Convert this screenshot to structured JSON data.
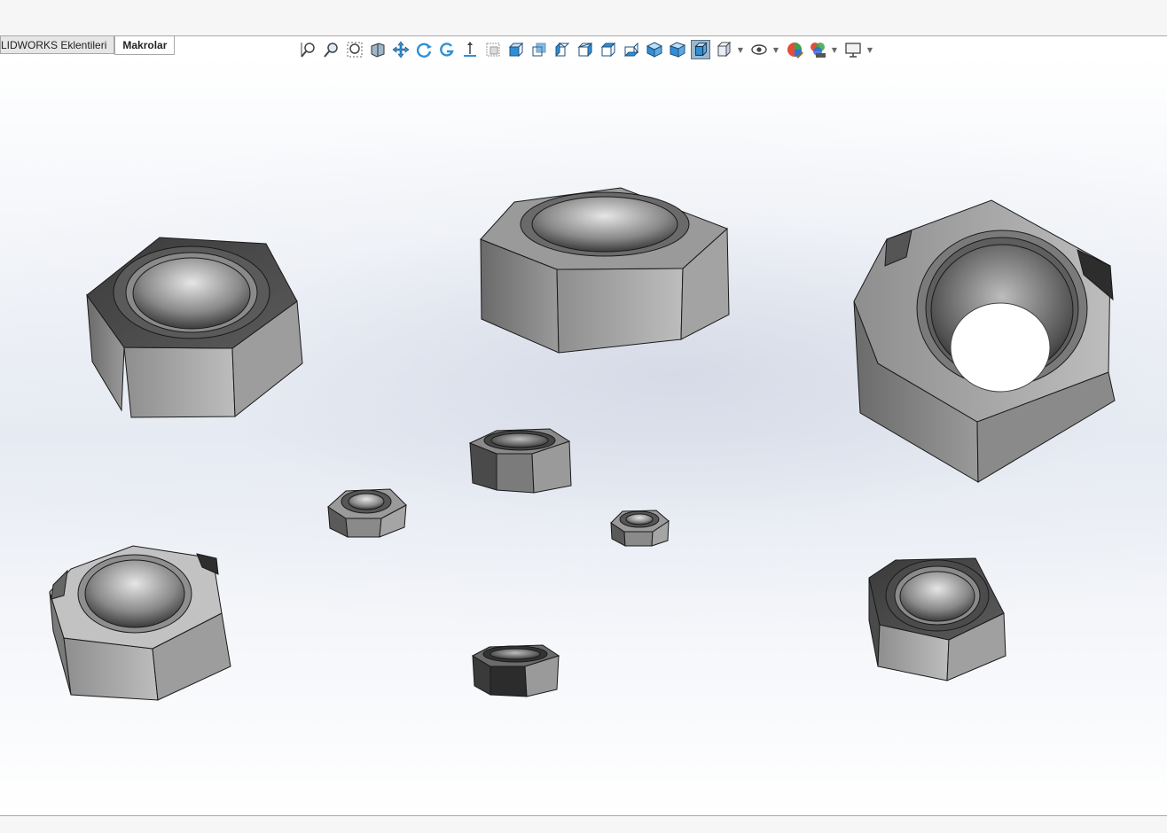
{
  "app": {
    "tabs": [
      {
        "id": "addins",
        "label": "LIDWORKS Eklentileri",
        "active": false
      },
      {
        "id": "macros",
        "label": "Makrolar",
        "active": true
      }
    ]
  },
  "toolbar": {
    "buttons": [
      {
        "name": "zoom-to-fit-icon",
        "dropdown": false
      },
      {
        "name": "zoom-to-area-icon",
        "dropdown": false
      },
      {
        "name": "zoom-in-out-icon",
        "dropdown": false
      },
      {
        "name": "section-view-icon",
        "dropdown": false
      },
      {
        "name": "pan-icon",
        "dropdown": false
      },
      {
        "name": "rotate-icon",
        "dropdown": false
      },
      {
        "name": "roll-view-icon",
        "dropdown": false
      },
      {
        "name": "normal-to-icon",
        "dropdown": false
      },
      {
        "name": "view-orientation-icon",
        "dropdown": false
      },
      {
        "name": "front-view-icon",
        "dropdown": false
      },
      {
        "name": "back-view-icon",
        "dropdown": false
      },
      {
        "name": "left-view-icon",
        "dropdown": false
      },
      {
        "name": "right-view-icon",
        "dropdown": false
      },
      {
        "name": "top-view-icon",
        "dropdown": false
      },
      {
        "name": "bottom-view-icon",
        "dropdown": false
      },
      {
        "name": "isometric-view-icon",
        "dropdown": false
      },
      {
        "name": "trimetric-view-icon",
        "dropdown": false
      },
      {
        "name": "shaded-with-edges-icon",
        "dropdown": false,
        "active": true
      },
      {
        "name": "display-style-icon",
        "dropdown": true
      },
      {
        "name": "hide-show-items-icon",
        "dropdown": true
      },
      {
        "name": "edit-appearance-icon",
        "dropdown": false
      },
      {
        "name": "apply-scene-icon",
        "dropdown": true
      },
      {
        "name": "view-settings-icon",
        "dropdown": true
      }
    ],
    "colors": {
      "accent": "#2f8fd6",
      "active_bg": "#9fb6c9"
    }
  },
  "model": {
    "parts": [
      "hex-nut",
      "hex-nut",
      "weld-nut",
      "weld-nut",
      "lock-nut",
      "lock-nut",
      "lock-nut",
      "lock-nut",
      "hex-nut"
    ]
  }
}
